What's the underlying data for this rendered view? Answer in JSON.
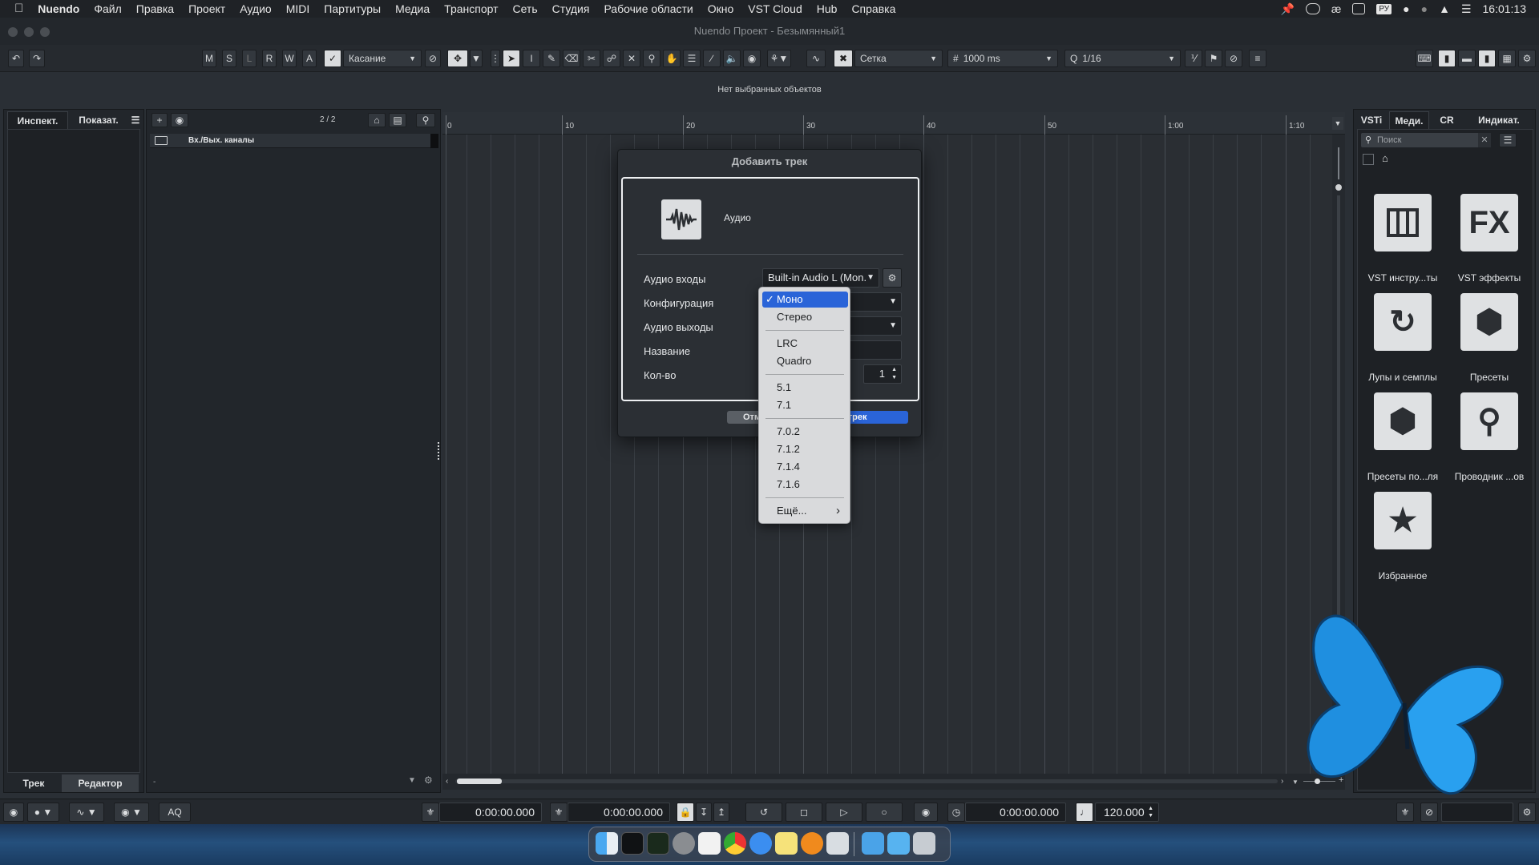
{
  "menubar": {
    "app_name": "Nuendo",
    "items": [
      "Файл",
      "Правка",
      "Проект",
      "Аудио",
      "MIDI",
      "Партитуры",
      "Медиа",
      "Транспорт",
      "Сеть",
      "Студия",
      "Рабочие области",
      "Окно",
      "VST Cloud",
      "Hub",
      "Справка"
    ],
    "input_source": "РУ",
    "clock": "16:01:13"
  },
  "window": {
    "title": "Nuendo Проект - Безымянный1"
  },
  "toolbar": {
    "state_buttons": [
      "M",
      "S",
      "L",
      "R",
      "W",
      "A"
    ],
    "automation_mode": "Касание",
    "snap_type": "Сетка",
    "grid_value": "1000 ms",
    "quantize": "1/16"
  },
  "info_line": "Нет выбранных объектов",
  "inspector": {
    "tab_inspector": "Инспект.",
    "tab_show": "Показат.",
    "bottom_track": "Трек",
    "bottom_editor": "Редактор"
  },
  "tracklist": {
    "counter": "2 / 2",
    "io_channels": "Вх./Вых. каналы",
    "bottom_dash": "-"
  },
  "ruler": {
    "labels": [
      "0",
      "10",
      "20",
      "30",
      "40",
      "50",
      "1:00",
      "1:10"
    ]
  },
  "dialog": {
    "title": "Добавить трек",
    "track_type": "Аудио",
    "label_inputs": "Аудио входы",
    "input_value": "Built-in Audio L (Mon.",
    "label_config": "Конфигурация",
    "label_outputs": "Аудио выходы",
    "label_name": "Название",
    "label_count": "Кол-во",
    "count_value": "1",
    "cancel_label": "Отм",
    "add_label": "вить трек"
  },
  "config_menu": {
    "checkmark": "✓",
    "items": [
      "Моно",
      "Стерео",
      "LRC",
      "Quadro",
      "5.1",
      "7.1",
      "7.0.2",
      "7.1.2",
      "7.1.4",
      "7.1.6",
      "Ещё..."
    ],
    "selected": "Моно",
    "submenu_arrow": "›"
  },
  "right_zone": {
    "tabs": [
      "VSTi",
      "Меди.",
      "CR",
      "Индикат."
    ],
    "search_placeholder": "Поиск",
    "tiles": [
      {
        "label": "VST инстру...ты",
        "icon": "piano-keys-icon"
      },
      {
        "label": "VST эффекты",
        "icon": "fx-icon",
        "glyph": "FX"
      },
      {
        "label": "Лупы и семплы",
        "icon": "loop-icon"
      },
      {
        "label": "Пресеты",
        "icon": "hexagons-icon"
      },
      {
        "label": "Пресеты по...ля",
        "icon": "user-preset-icon"
      },
      {
        "label": "Проводник ...ов",
        "icon": "browser-icon"
      },
      {
        "label": "Избранное",
        "icon": "star-icon"
      }
    ]
  },
  "transport": {
    "left_locator": "0:00:00.000",
    "right_locator": "0:00:00.000",
    "position": "0:00:00.000",
    "tempo": "120.000",
    "aq_label": "AQ"
  },
  "colors": {
    "accent": "#2a64d8",
    "bg": "#2a2f35",
    "panel": "#22262b"
  }
}
